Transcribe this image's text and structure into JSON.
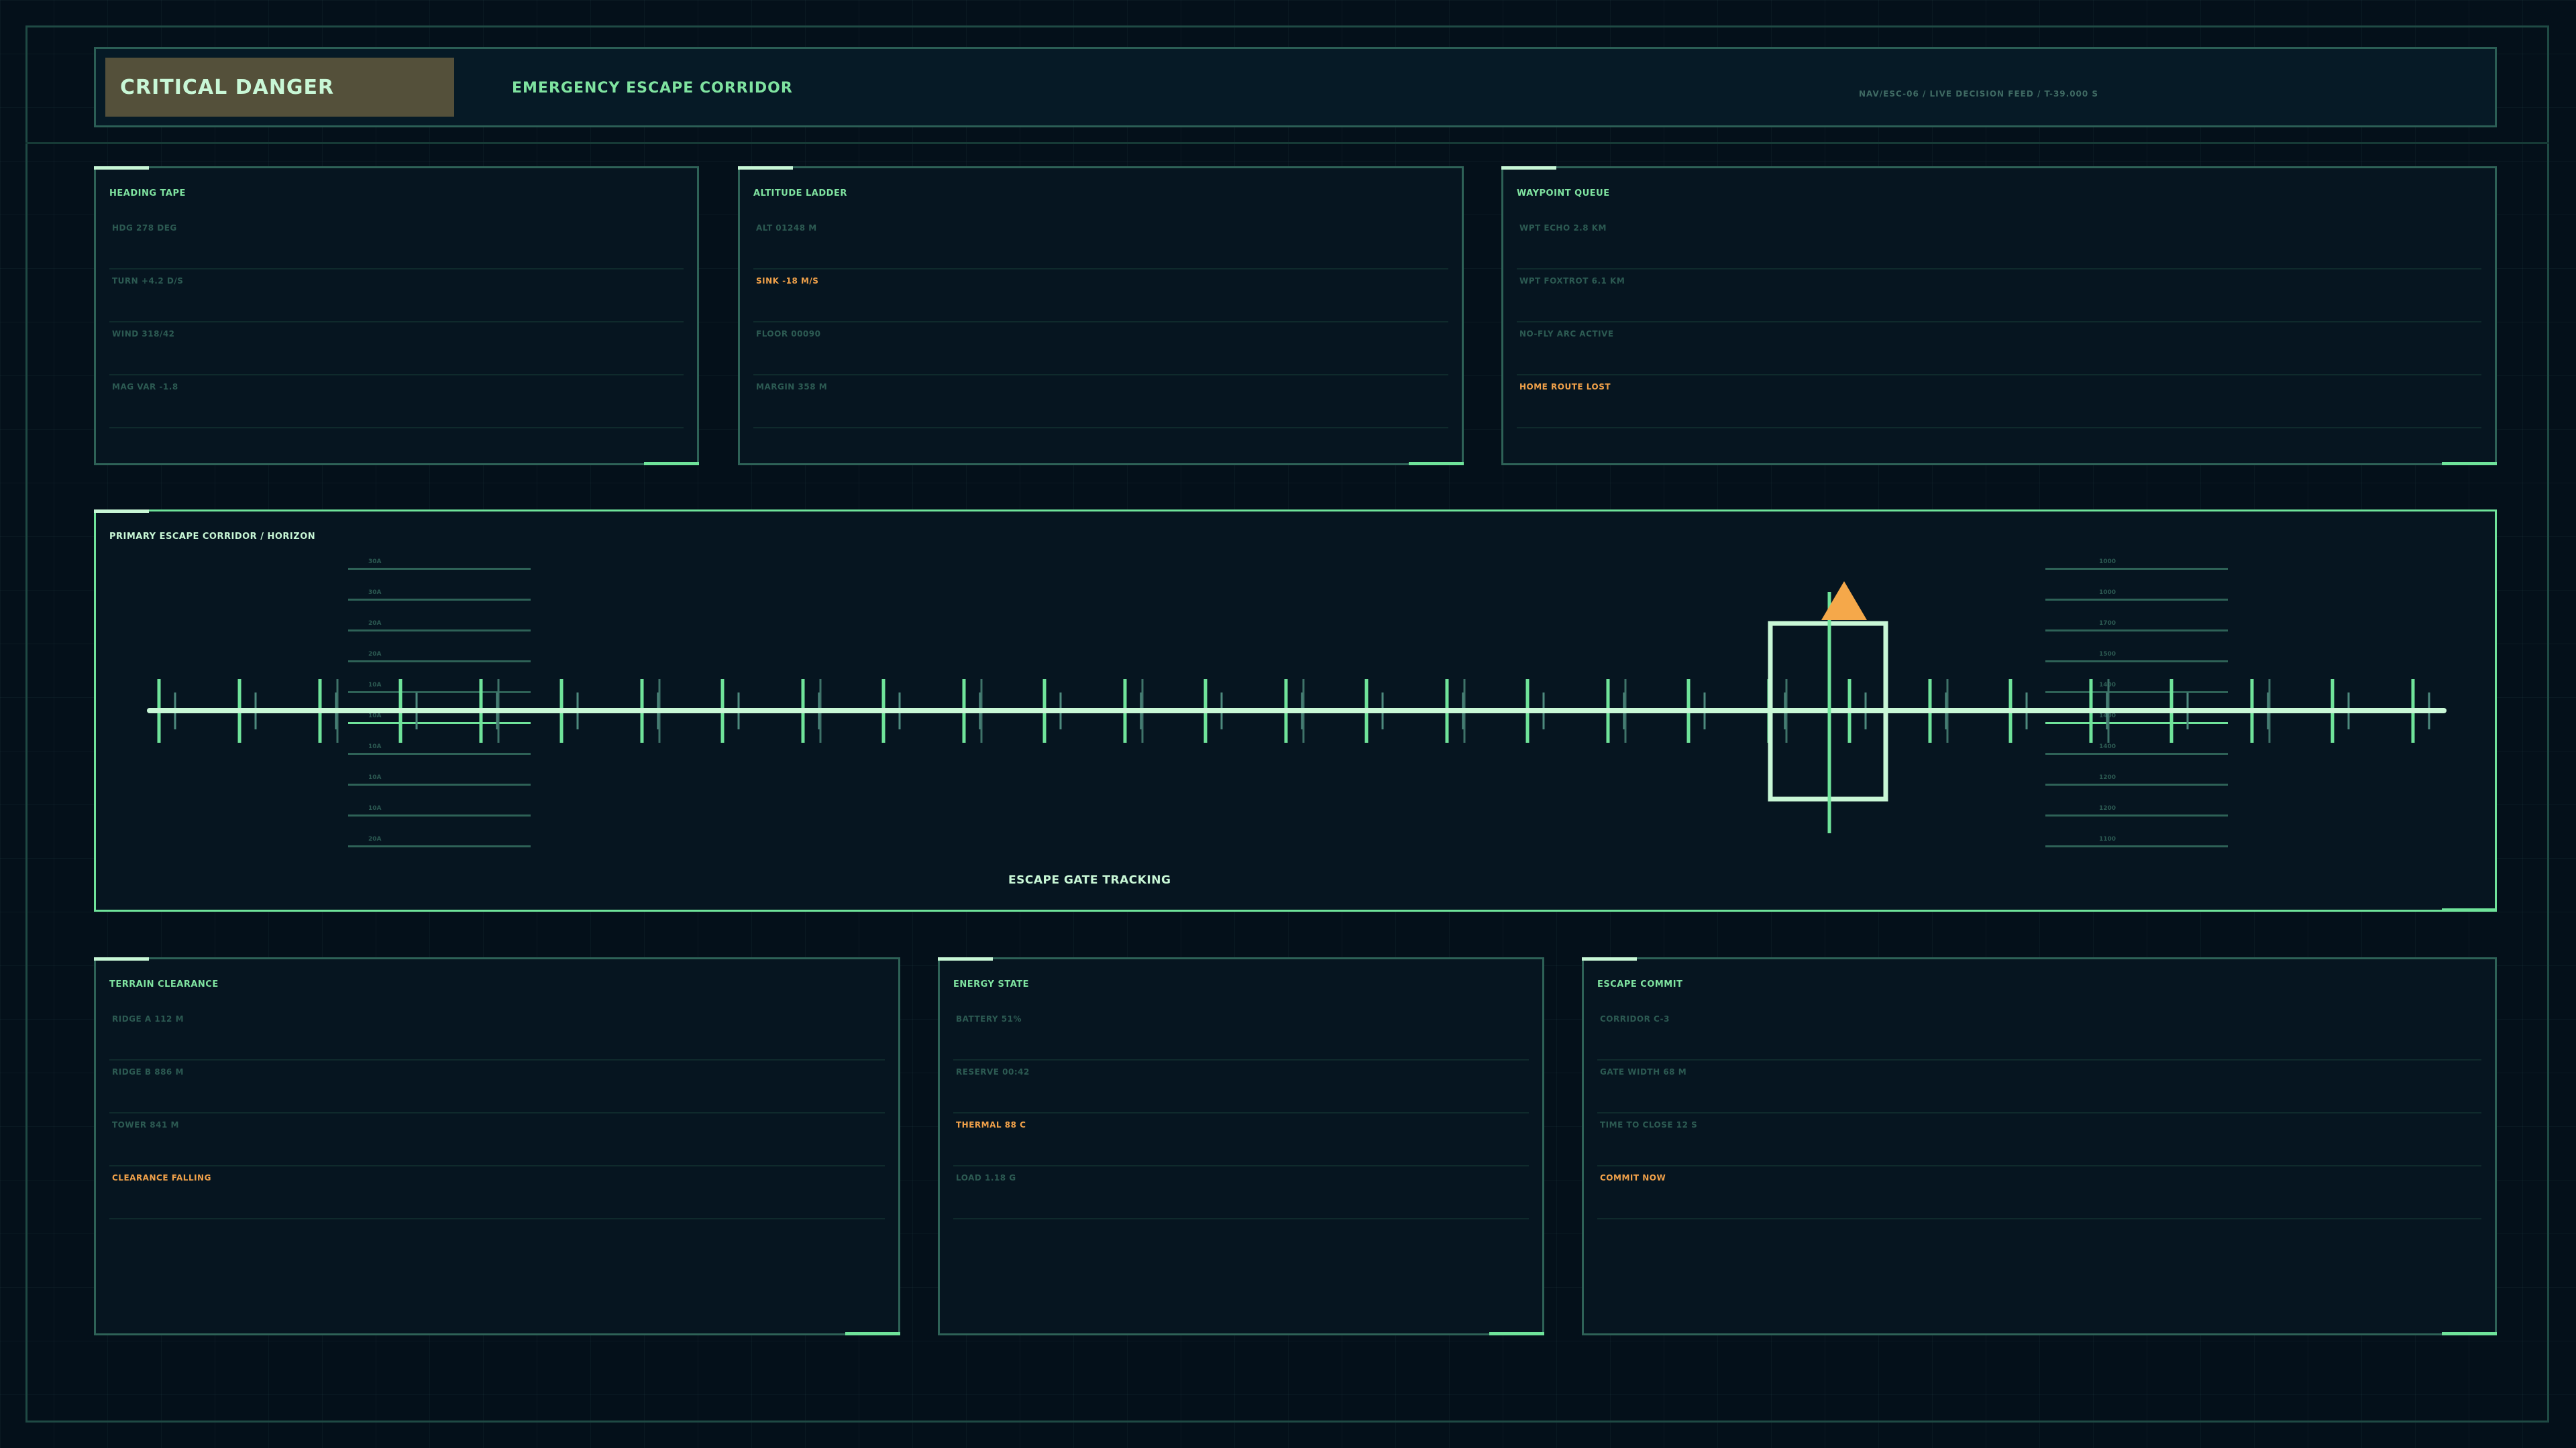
{
  "header": {
    "status_badge": "CRITICAL DANGER",
    "title": "EMERGENCY ESCAPE CORRIDOR",
    "meta": "NAV/ESC-06  /  LIVE DECISION FEED  /  T-39.000 S"
  },
  "colors": {
    "accent": "#6fe39a",
    "warning": "#f0a14a",
    "badge_bg": "#54503a",
    "background": "#04101a"
  },
  "panels": {
    "heading": {
      "title": "HEADING TAPE",
      "rows": [
        {
          "text": "HDG 278 DEG",
          "warn": false
        },
        {
          "text": "TURN +4.2 D/S",
          "warn": false
        },
        {
          "text": "WIND 318/42",
          "warn": false
        },
        {
          "text": "MAG VAR -1.8",
          "warn": false
        }
      ]
    },
    "altitude": {
      "title": "ALTITUDE LADDER",
      "rows": [
        {
          "text": "ALT 01248 M",
          "warn": false
        },
        {
          "text": "SINK -18 M/S",
          "warn": true
        },
        {
          "text": "FLOOR 00090",
          "warn": false
        },
        {
          "text": "MARGIN 358 M",
          "warn": false
        }
      ]
    },
    "waypoint": {
      "title": "WAYPOINT QUEUE",
      "rows": [
        {
          "text": "WPT ECHO 2.8 KM",
          "warn": false
        },
        {
          "text": "WPT FOXTROT 6.1 KM",
          "warn": false
        },
        {
          "text": "NO-FLY ARC ACTIVE",
          "warn": false
        },
        {
          "text": "HOME ROUTE LOST",
          "warn": true
        }
      ]
    },
    "terrain": {
      "title": "TERRAIN CLEARANCE",
      "rows": [
        {
          "text": "RIDGE A 112 M",
          "warn": false
        },
        {
          "text": "RIDGE B 886 M",
          "warn": false
        },
        {
          "text": "TOWER 841 M",
          "warn": false
        },
        {
          "text": "CLEARANCE FALLING",
          "warn": true
        }
      ]
    },
    "energy": {
      "title": "ENERGY STATE",
      "rows": [
        {
          "text": "BATTERY 51%",
          "warn": false
        },
        {
          "text": "RESERVE 00:42",
          "warn": false
        },
        {
          "text": "THERMAL 88 C",
          "warn": true
        },
        {
          "text": "LOAD 1.18 G",
          "warn": false
        }
      ]
    },
    "commit": {
      "title": "ESCAPE COMMIT",
      "rows": [
        {
          "text": "CORRIDOR C-3",
          "warn": false
        },
        {
          "text": "GATE WIDTH 68 M",
          "warn": false
        },
        {
          "text": "TIME TO CLOSE 12 S",
          "warn": false
        },
        {
          "text": "COMMIT NOW",
          "warn": true
        }
      ]
    }
  },
  "main": {
    "title": "PRIMARY ESCAPE CORRIDOR / HORIZON",
    "gate_label": "ESCAPE GATE TRACKING",
    "left_ladder": [
      "30A",
      "30A",
      "20A",
      "20A",
      "10A",
      "10A",
      "10A",
      "10A",
      "10A",
      "20A"
    ],
    "right_ladder": [
      "1000",
      "1000",
      "1700",
      "1500",
      "1400",
      "1400",
      "1400",
      "1200",
      "1200",
      "1100"
    ],
    "icons": {
      "target": "target-reticle-icon",
      "warning": "warning-triangle-icon"
    }
  }
}
